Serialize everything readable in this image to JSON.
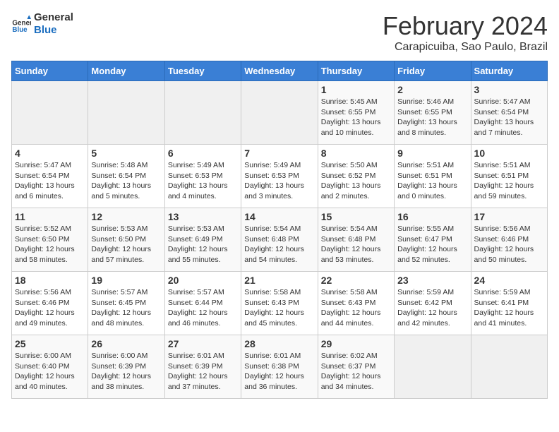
{
  "logo": {
    "line1": "General",
    "line2": "Blue"
  },
  "title": "February 2024",
  "location": "Carapicuiba, Sao Paulo, Brazil",
  "headers": [
    "Sunday",
    "Monday",
    "Tuesday",
    "Wednesday",
    "Thursday",
    "Friday",
    "Saturday"
  ],
  "weeks": [
    [
      {
        "day": "",
        "info": ""
      },
      {
        "day": "",
        "info": ""
      },
      {
        "day": "",
        "info": ""
      },
      {
        "day": "",
        "info": ""
      },
      {
        "day": "1",
        "info": "Sunrise: 5:45 AM\nSunset: 6:55 PM\nDaylight: 13 hours\nand 10 minutes."
      },
      {
        "day": "2",
        "info": "Sunrise: 5:46 AM\nSunset: 6:55 PM\nDaylight: 13 hours\nand 8 minutes."
      },
      {
        "day": "3",
        "info": "Sunrise: 5:47 AM\nSunset: 6:54 PM\nDaylight: 13 hours\nand 7 minutes."
      }
    ],
    [
      {
        "day": "4",
        "info": "Sunrise: 5:47 AM\nSunset: 6:54 PM\nDaylight: 13 hours\nand 6 minutes."
      },
      {
        "day": "5",
        "info": "Sunrise: 5:48 AM\nSunset: 6:54 PM\nDaylight: 13 hours\nand 5 minutes."
      },
      {
        "day": "6",
        "info": "Sunrise: 5:49 AM\nSunset: 6:53 PM\nDaylight: 13 hours\nand 4 minutes."
      },
      {
        "day": "7",
        "info": "Sunrise: 5:49 AM\nSunset: 6:53 PM\nDaylight: 13 hours\nand 3 minutes."
      },
      {
        "day": "8",
        "info": "Sunrise: 5:50 AM\nSunset: 6:52 PM\nDaylight: 13 hours\nand 2 minutes."
      },
      {
        "day": "9",
        "info": "Sunrise: 5:51 AM\nSunset: 6:51 PM\nDaylight: 13 hours\nand 0 minutes."
      },
      {
        "day": "10",
        "info": "Sunrise: 5:51 AM\nSunset: 6:51 PM\nDaylight: 12 hours\nand 59 minutes."
      }
    ],
    [
      {
        "day": "11",
        "info": "Sunrise: 5:52 AM\nSunset: 6:50 PM\nDaylight: 12 hours\nand 58 minutes."
      },
      {
        "day": "12",
        "info": "Sunrise: 5:53 AM\nSunset: 6:50 PM\nDaylight: 12 hours\nand 57 minutes."
      },
      {
        "day": "13",
        "info": "Sunrise: 5:53 AM\nSunset: 6:49 PM\nDaylight: 12 hours\nand 55 minutes."
      },
      {
        "day": "14",
        "info": "Sunrise: 5:54 AM\nSunset: 6:48 PM\nDaylight: 12 hours\nand 54 minutes."
      },
      {
        "day": "15",
        "info": "Sunrise: 5:54 AM\nSunset: 6:48 PM\nDaylight: 12 hours\nand 53 minutes."
      },
      {
        "day": "16",
        "info": "Sunrise: 5:55 AM\nSunset: 6:47 PM\nDaylight: 12 hours\nand 52 minutes."
      },
      {
        "day": "17",
        "info": "Sunrise: 5:56 AM\nSunset: 6:46 PM\nDaylight: 12 hours\nand 50 minutes."
      }
    ],
    [
      {
        "day": "18",
        "info": "Sunrise: 5:56 AM\nSunset: 6:46 PM\nDaylight: 12 hours\nand 49 minutes."
      },
      {
        "day": "19",
        "info": "Sunrise: 5:57 AM\nSunset: 6:45 PM\nDaylight: 12 hours\nand 48 minutes."
      },
      {
        "day": "20",
        "info": "Sunrise: 5:57 AM\nSunset: 6:44 PM\nDaylight: 12 hours\nand 46 minutes."
      },
      {
        "day": "21",
        "info": "Sunrise: 5:58 AM\nSunset: 6:43 PM\nDaylight: 12 hours\nand 45 minutes."
      },
      {
        "day": "22",
        "info": "Sunrise: 5:58 AM\nSunset: 6:43 PM\nDaylight: 12 hours\nand 44 minutes."
      },
      {
        "day": "23",
        "info": "Sunrise: 5:59 AM\nSunset: 6:42 PM\nDaylight: 12 hours\nand 42 minutes."
      },
      {
        "day": "24",
        "info": "Sunrise: 5:59 AM\nSunset: 6:41 PM\nDaylight: 12 hours\nand 41 minutes."
      }
    ],
    [
      {
        "day": "25",
        "info": "Sunrise: 6:00 AM\nSunset: 6:40 PM\nDaylight: 12 hours\nand 40 minutes."
      },
      {
        "day": "26",
        "info": "Sunrise: 6:00 AM\nSunset: 6:39 PM\nDaylight: 12 hours\nand 38 minutes."
      },
      {
        "day": "27",
        "info": "Sunrise: 6:01 AM\nSunset: 6:39 PM\nDaylight: 12 hours\nand 37 minutes."
      },
      {
        "day": "28",
        "info": "Sunrise: 6:01 AM\nSunset: 6:38 PM\nDaylight: 12 hours\nand 36 minutes."
      },
      {
        "day": "29",
        "info": "Sunrise: 6:02 AM\nSunset: 6:37 PM\nDaylight: 12 hours\nand 34 minutes."
      },
      {
        "day": "",
        "info": ""
      },
      {
        "day": "",
        "info": ""
      }
    ]
  ]
}
